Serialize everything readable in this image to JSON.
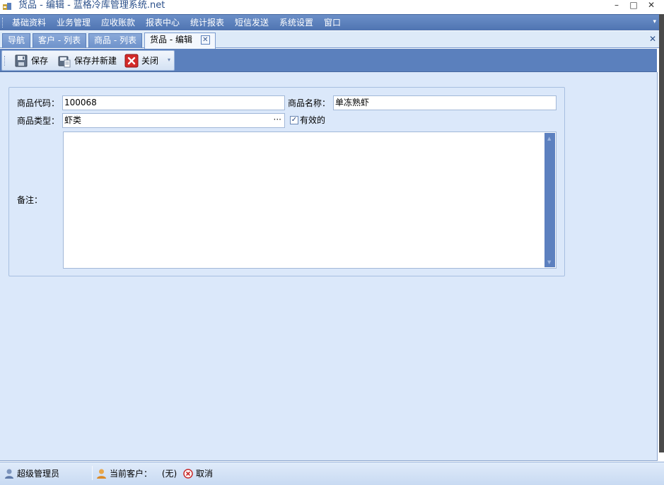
{
  "window": {
    "title": "货品 - 编辑 - 蓝格冷库管理系统.net",
    "minimize": "–",
    "maximize": "□",
    "close": "✕"
  },
  "menu": {
    "items": [
      "基础资料",
      "业务管理",
      "应收账款",
      "报表中心",
      "统计报表",
      "短信发送",
      "系统设置",
      "窗口"
    ]
  },
  "tabs": [
    {
      "label": "导航",
      "active": false
    },
    {
      "label": "客户 - 列表",
      "active": false
    },
    {
      "label": "商品 - 列表",
      "active": false
    },
    {
      "label": "货品 - 编辑",
      "active": true
    }
  ],
  "tab_close": "✕",
  "strip_close": "✕",
  "toolbar": {
    "save_label": "保存",
    "save_new_label": "保存并新建",
    "close_label": "关闭",
    "overflow_arrow": "▾"
  },
  "form": {
    "code_label": "商品代码：",
    "code_value": "100068",
    "name_label": "商品名称：",
    "name_value": "单冻熟虾",
    "type_label": "商品类型：",
    "type_value": "虾类",
    "type_button": "···",
    "valid_label": "有效的",
    "valid_checked": true,
    "remark_label": "备注：",
    "remark_value": ""
  },
  "status": {
    "user": "超级管理员",
    "customer_label": "当前客户：",
    "customer_value": "(无)",
    "cancel_label": "取消"
  },
  "colors": {
    "accent": "#5b80bd",
    "background": "#dbe8fa",
    "close_red": "#d32a2a"
  }
}
